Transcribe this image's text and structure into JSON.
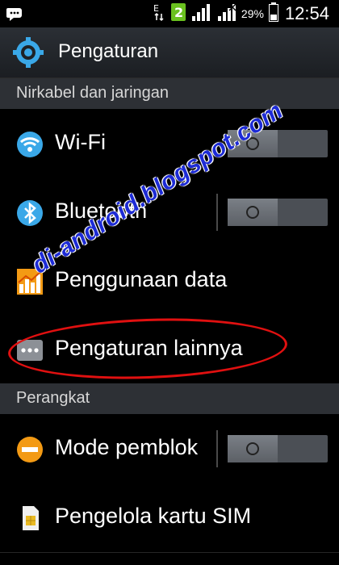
{
  "status_bar": {
    "time": "12:54",
    "battery_percent": "29%",
    "network_type": "E",
    "notification_badge": "2",
    "icons": [
      "bbm-icon",
      "network-e-icon",
      "notification-2-icon",
      "signal-icon",
      "signal-icon",
      "battery-icon"
    ]
  },
  "action_bar": {
    "title": "Pengaturan",
    "icon": "gear-icon"
  },
  "sections": [
    {
      "title": "Nirkabel dan jaringan"
    },
    {
      "title": "Perangkat"
    }
  ],
  "items": [
    {
      "label": "Wi-Fi",
      "icon": "wifi-icon",
      "toggle": "off"
    },
    {
      "label": "Bluetooth",
      "icon": "bluetooth-icon",
      "toggle": "off"
    },
    {
      "label": "Penggunaan data",
      "icon": "data-usage-icon"
    },
    {
      "label": "Pengaturan lainnya",
      "icon": "more-icon"
    },
    {
      "label": "Mode pemblok",
      "icon": "block-mode-icon",
      "toggle": "off"
    },
    {
      "label": "Pengelola kartu SIM",
      "icon": "sim-card-icon"
    }
  ],
  "watermark": {
    "text": "di-android.blogspot.com"
  },
  "colors": {
    "accent_blue": "#3aa8e8",
    "annotation_red": "#e01010",
    "watermark_blue": "#1d2bd6",
    "section_bg": "#2d3035"
  }
}
